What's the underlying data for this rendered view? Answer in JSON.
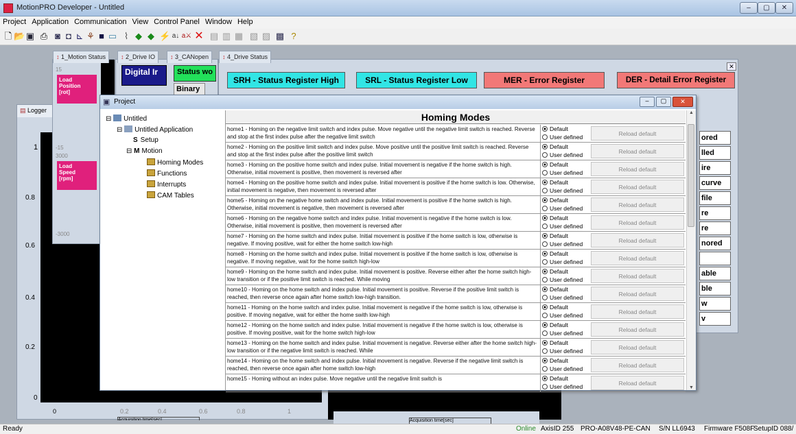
{
  "app": {
    "title": "MotionPRO Developer - Untitled"
  },
  "window_controls": {
    "minimize": "–",
    "restore": "▢",
    "close": "✕"
  },
  "menu": [
    "Project",
    "Application",
    "Communication",
    "View",
    "Control Panel",
    "Window",
    "Help"
  ],
  "toolbar_icons": [
    "new-icon",
    "open-icon",
    "save-icon",
    "print-icon",
    "setup-icon",
    "run-icon",
    "stop-icon",
    "axis-icon",
    "data-icon",
    "chart-icon",
    "motion-icon",
    "diamond-icon",
    "diamond2-icon",
    "speed-icon",
    "list-icon",
    "cross-icon",
    "compile-icon",
    "build-icon",
    "upload-icon",
    "download-icon",
    "flash-icon",
    "download2-icon",
    "help-icon"
  ],
  "mdi_tabs": [
    "1_Motion Status",
    "2_Drive IO",
    "3_CANopen",
    "4_Drive Status"
  ],
  "logger_tab": "Logger",
  "motion_status": {
    "load_position": [
      "Load",
      "Position",
      "[rot]"
    ],
    "load_speed": [
      "Load",
      "Speed",
      "[rpm]"
    ],
    "pos_top": "15",
    "pos_bottom": "-15",
    "speed_top": "3000",
    "speed_bottom": "-3000"
  },
  "drive_io": {
    "digital": "Digital Ir",
    "status": "Status wo",
    "binary": "Binary"
  },
  "drive_status": {
    "srh": "SRH - Status Register High",
    "srl": "SRL - Status Register Low",
    "mer": "MER - Error Register",
    "der": "DER - Detail Error Register",
    "der_cells": [
      "ored",
      "lled",
      "ire",
      "curve",
      "file",
      "re",
      "re",
      "nored",
      "",
      "able",
      "ble",
      "w",
      "v"
    ]
  },
  "logger": {
    "y_ticks": [
      "1",
      "0.8",
      "0.6",
      "0.4",
      "0.2",
      "0"
    ],
    "x_ticks": [
      "0",
      "0.2",
      "0.4",
      "0.6",
      "0.8",
      "1"
    ],
    "x_label": "Acquisition time[sec]"
  },
  "project": {
    "title": "Project",
    "tree": {
      "root": "Untitled",
      "application": "Untitled Application",
      "setup": "Setup",
      "motion": "Motion",
      "homing": "Homing Modes",
      "functions": "Functions",
      "interrupts": "Interrupts",
      "cam": "CAM Tables"
    },
    "grid_title": "Homing Modes",
    "opt_default": "Default",
    "opt_user": "User defined",
    "reload_label": "Reload default",
    "rows": [
      "home1 - Homing on the negative limit switch and index pulse. Move negative until the negative limit switch is reached. Reverse and stop at the first index pulse after the negative limit switch",
      "home2 - Homing on the positive limit switch and index pulse. Move positive until the positive limit switch is reached. Reverse and stop at the first index pulse after the positive limit switch",
      "home3 - Homing on the positive home switch and index pulse. Initial movement is negative if the home switch is high. Otherwise, initial movement is positive, then movement is reversed after",
      "home4 - Homing on the positive home switch and index pulse. Initial movement is positive if the home switch is low. Otherwise, initial movement is negative, then movement is reversed after",
      "home5 - Homing on the negative home switch and index pulse. Initial movement is positive if the home switch is high. Otherwise, initial movement is negative, then movement is reversed after",
      "home6 - Homing on the negative home switch and index pulse. Initial movement is negative if the home switch is low. Otherwise, initial movement is positive, then movement is reversed after",
      "home7 - Homing on the home switch and index pulse. Initial movement is positive if the home switch is low, otherwise is negative. If moving positive, wait for either the home switch low-high",
      "home8 - Homing on the home switch and index pulse. Initial movement is positive if the home switch is low, otherwise is negative. If moving negative, wait for the home switch high-low",
      "home9 - Homing on the home switch and index pulse. Initial movement is positive. Reverse either after the home switch high-low transition or if the positive limit switch is reached. While moving",
      "home10 - Homing on the home switch and index pulse. Initial movement is positive. Reverse if the positive limit switch is reached, then reverse once again after home switch low-high transition.",
      "home11 - Homing on the home switch and index pulse. Initial movement is negative if the home switch is low, otherwise is positive. If moving negative, wait for either the home swith low-high",
      "home12 - Homing on the home switch and index pulse. Initial movement is negative if the home switch is low, otherwise is positive. If moving positive, wait for the home switch high-low",
      "home13 - Homing on the home switch and index pulse. Initial movement is negative. Reverse either after the home switch high-low transition or if the negative limit switch is reached. While",
      "home14 - Homing on the home switch and index pulse. Initial movement is negative. Reverse if the negative limit switch is reached, then reverse once again after home switch low-high",
      "home15 - Homing without an index pulse. Move negative until the negative limit switch is"
    ]
  },
  "status": {
    "ready": "Ready",
    "online": "Online",
    "axis": "AxisID 255",
    "drive": "PRO-A08V48-PE-CAN",
    "sn": "S/N LL6943",
    "firmware": "Firmware F508F",
    "setup": "SetupID 088/"
  }
}
